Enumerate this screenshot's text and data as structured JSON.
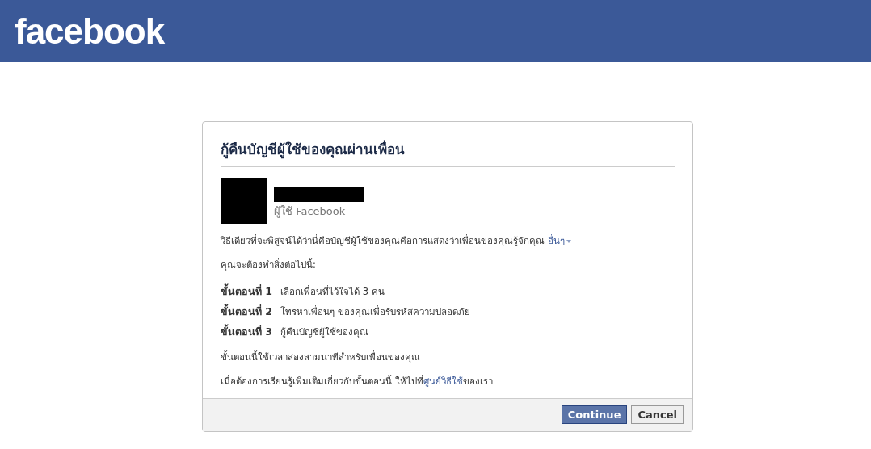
{
  "header": {
    "logo": "facebook"
  },
  "dialog": {
    "title": "กู้คืนบัญชีผู้ใช้ของคุณผ่านเพื่อน",
    "account": {
      "subtitle": "ผู้ใช้ Facebook"
    },
    "intro": {
      "text": "วิธีเดียวที่จะพิสูจน์ได้ว่านี่คือบัญชีผู้ใช้ของคุณคือการแสดงว่าเพื่อนของคุณรู้จักคุณ",
      "more_link": "อื่นๆ"
    },
    "lead": "คุณจะต้องทำสิ่งต่อไปนี้:",
    "steps": [
      {
        "label": "ขั้นตอนที่ 1",
        "text": "เลือกเพื่อนที่ไว้ใจได้ 3 คน"
      },
      {
        "label": "ขั้นตอนที่ 2",
        "text": "โทรหาเพื่อนๆ ของคุณเพื่อรับรหัสความปลอดภัย"
      },
      {
        "label": "ขั้นตอนที่ 3",
        "text": "กู้คืนบัญชีผู้ใช้ของคุณ"
      }
    ],
    "note": "ขั้นตอนนี้ใช้เวลาสองสามนาทีสำหรับเพื่อนของคุณ",
    "learn_more": {
      "before": "เมื่อต้องการเรียนรู้เพิ่มเติมเกี่ยวกับขั้นตอนนี้ ให้ไปที่",
      "link": "ศูนย์วิธีใช้",
      "after": "ของเรา"
    },
    "buttons": [
      {
        "kind": "primary",
        "label": "Continue"
      },
      {
        "kind": "secondary",
        "label": "Cancel"
      }
    ]
  }
}
